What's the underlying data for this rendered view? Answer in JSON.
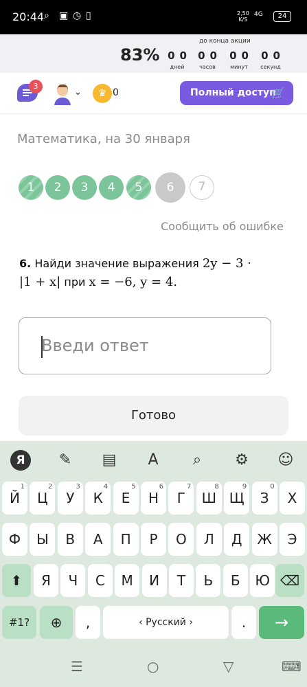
{
  "status": {
    "time": "20:44",
    "speed_value": "2,50",
    "speed_unit": "K/S",
    "network": "4G",
    "battery": "24"
  },
  "promo": {
    "percent": "83%",
    "caption": "до конца акции",
    "countdown": [
      {
        "value": "00",
        "label": "дней"
      },
      {
        "value": "00",
        "label": "часов"
      },
      {
        "value": "00",
        "label": "минут"
      },
      {
        "value": "00",
        "label": "секунд"
      }
    ]
  },
  "header": {
    "chat_badge": "3",
    "coins": "0",
    "full_access": "Полный доступ",
    "coin_symbol": "♛"
  },
  "subject": "Математика, на 30 января",
  "steps": [
    {
      "label": "1",
      "state": "done-striped"
    },
    {
      "label": "2",
      "state": "done"
    },
    {
      "label": "3",
      "state": "done"
    },
    {
      "label": "4",
      "state": "done"
    },
    {
      "label": "5",
      "state": "done-striped"
    },
    {
      "label": "6",
      "state": "current"
    },
    {
      "label": "7",
      "state": "todo"
    }
  ],
  "report": "Сообщить об ошибке",
  "question": {
    "number": "6.",
    "text1": "Найди значение выражения",
    "expr1": "2y − 3 ·",
    "expr2": "|1 + x|",
    "text2": "при",
    "expr3": "x = −6, y = 4."
  },
  "answer": {
    "placeholder": "Введи ответ",
    "value": ""
  },
  "done_label": "Готово",
  "keyboard": {
    "toolbar": [
      {
        "icon": "yandex-icon",
        "glyph": "Я"
      },
      {
        "icon": "magic-wand-icon",
        "glyph": "✎"
      },
      {
        "icon": "clipboard-icon",
        "glyph": "▤"
      },
      {
        "icon": "translate-icon",
        "glyph": "A"
      },
      {
        "icon": "search-icon",
        "glyph": "⌕"
      },
      {
        "icon": "settings-icon",
        "glyph": "⚙"
      },
      {
        "icon": "emoji-icon",
        "glyph": "☺"
      }
    ],
    "row1": [
      {
        "k": "Й",
        "n": "1"
      },
      {
        "k": "Ц",
        "n": "2"
      },
      {
        "k": "У",
        "n": "3"
      },
      {
        "k": "К",
        "n": "4"
      },
      {
        "k": "Е",
        "n": "5"
      },
      {
        "k": "Н",
        "n": "6"
      },
      {
        "k": "Г",
        "n": "7"
      },
      {
        "k": "Ш",
        "n": "8"
      },
      {
        "k": "Щ",
        "n": "9"
      },
      {
        "k": "З",
        "n": "0"
      },
      {
        "k": "Х",
        "n": ""
      }
    ],
    "row2": [
      "Ф",
      "Ы",
      "В",
      "А",
      "П",
      "Р",
      "О",
      "Л",
      "Д",
      "Ж",
      "Э"
    ],
    "row3": [
      "Я",
      "Ч",
      "С",
      "М",
      "И",
      "Т",
      "Ь",
      "Б",
      "Ю"
    ],
    "symbols": "#1?",
    "comma": ",",
    "space": "‹  Русский  ›",
    "period": ".",
    "shift": "⬆",
    "backspace": "⌫",
    "enter": "→",
    "globe": "⊕",
    "mic": "🎤"
  },
  "nav": {
    "menu": "☰",
    "home": "○",
    "back": "▽",
    "keyboard": "⌨"
  }
}
